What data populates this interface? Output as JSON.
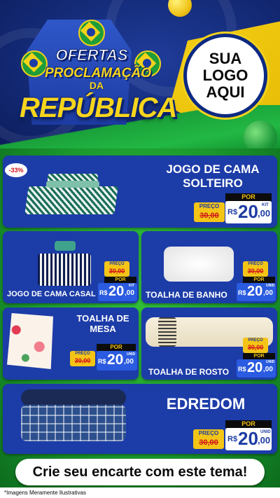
{
  "header": {
    "title_line1": "OFERTAS",
    "title_line2": "PROCLAMAÇÃO",
    "title_line3": "DA",
    "title_line4": "REPÚBLICA",
    "logo_placeholder": [
      "SUA",
      "LOGO",
      "AQUI"
    ]
  },
  "products": [
    {
      "name": "JOGO DE CAMA\nSOLTEIRO",
      "name_line1": "JOGO DE CAMA",
      "name_line2": "SOLTEIRO",
      "discount": "-33%",
      "price_label": "PREÇO",
      "old_price": "30,00",
      "por_label": "POR",
      "currency": "R$",
      "price_int": "20",
      "price_dec": ",00",
      "unit": "KIT"
    },
    {
      "name": "JOGO DE CAMA CASAL",
      "price_label": "PREÇO",
      "old_price": "30,00",
      "por_label": "POR",
      "currency": "R$",
      "price_int": "20",
      "price_dec": ",00",
      "unit": "KIT"
    },
    {
      "name": "TOALHA DE BANHO",
      "price_label": "PREÇO",
      "old_price": "30,00",
      "por_label": "POR",
      "currency": "R$",
      "price_int": "20",
      "price_dec": ",00",
      "unit": "UNID"
    },
    {
      "name_line1": "TOALHA DE",
      "name_line2": "MESA",
      "price_label": "PREÇO",
      "old_price": "30,00",
      "por_label": "POR",
      "currency": "R$",
      "price_int": "20",
      "price_dec": ",00",
      "unit": "UNID"
    },
    {
      "name": "TOALHA DE ROSTO",
      "price_label": "PREÇO",
      "old_price": "30,00",
      "por_label": "POR",
      "currency": "R$",
      "price_int": "20",
      "price_dec": ",00",
      "unit": "UNID"
    },
    {
      "name": "EDREDOM",
      "price_label": "PREÇO",
      "old_price": "30,00",
      "por_label": "POR",
      "currency": "R$",
      "price_int": "20",
      "price_dec": ",00",
      "unit": "UNID"
    }
  ],
  "cta": "Crie seu encarte com este tema!",
  "disclaimer": "*Imagens Meramente Ilustrativas",
  "colors": {
    "card_blue": "#1c3ca8",
    "price_blue": "#2a5be0",
    "tag_yellow": "#f4c517",
    "old_price_red": "#d0101b",
    "green_bg": "#22b844"
  }
}
